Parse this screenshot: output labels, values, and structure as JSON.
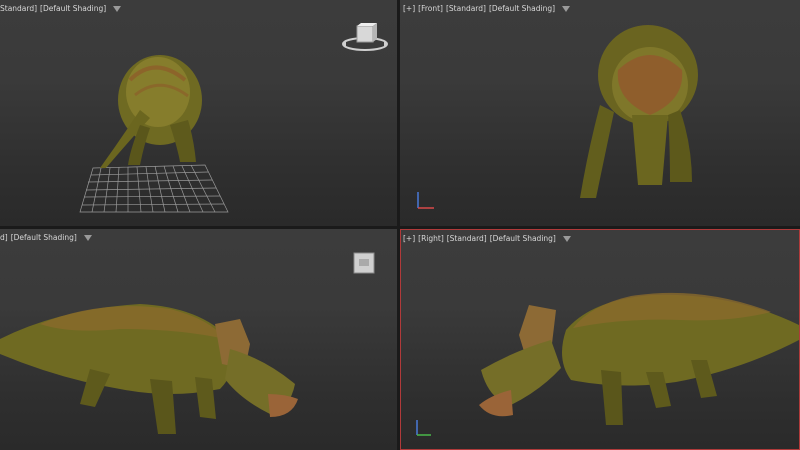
{
  "viewports": {
    "top_left": {
      "label_segments": [
        "Standard]",
        "[Default Shading]"
      ]
    },
    "top_right": {
      "label_segments": [
        "[+]",
        "[Front]",
        "[Standard]",
        "[Default Shading]"
      ]
    },
    "bottom_left": {
      "label_segments": [
        "d]",
        "[Default Shading]"
      ]
    },
    "bottom_right": {
      "label_segments": [
        "[+]",
        "[Right]",
        "[Standard]",
        "[Default Shading]"
      ],
      "active": true
    }
  },
  "icons": {
    "viewport_menu": "filter-funnel-icon",
    "viewcube": "viewcube-icon",
    "axis": "axis-tripod-icon"
  },
  "colors": {
    "active_border": "#b03a3a",
    "dino_body": "#7a7a2a",
    "dino_stripes": "#a0502a"
  }
}
